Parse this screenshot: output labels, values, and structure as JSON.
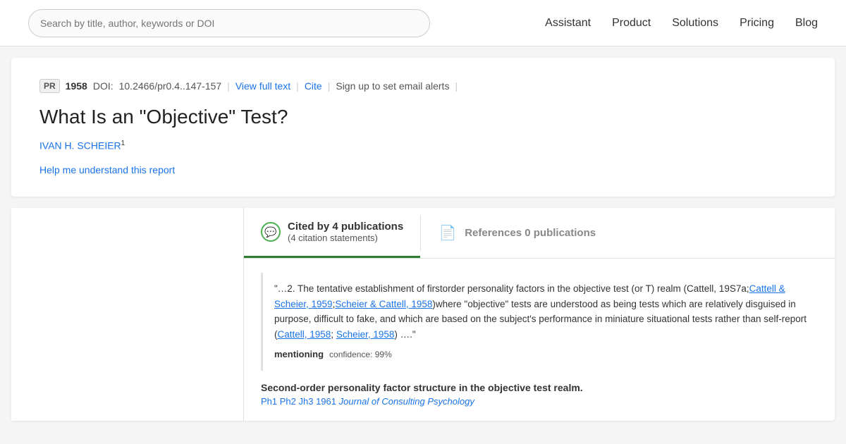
{
  "header": {
    "search_placeholder": "Search by title, author, keywords or DOI",
    "nav_items": [
      "Assistant",
      "Product",
      "Solutions",
      "Pricing",
      "Blog"
    ]
  },
  "article": {
    "badge": "PR",
    "year": "1958",
    "doi_label": "DOI:",
    "doi_value": "10.2466/pr0.4..147-157",
    "view_full_text": "View full text",
    "cite": "Cite",
    "alert": "Sign up to set email alerts",
    "title": "What Is an \"Objective\" Test?",
    "author": "IVAN H. SCHEIER",
    "author_sup": "1",
    "help_link": "Help me understand this report"
  },
  "tabs": {
    "cited_by": {
      "icon": "💬",
      "title": "Cited by 4 publications",
      "subtitle": "(4 citation statements)"
    },
    "references": {
      "icon": "📄",
      "title": "References 0 publications"
    }
  },
  "citation": {
    "text_start": "\"…2. The tentative establishment of firstorder personality factors in the objective test (or T) realm (Cattell, 19S7a;",
    "link1": "Cattell & Scheier, 1959",
    "text2": ";",
    "link2": "Scheier & Cattell, 1958",
    "text3": ")where \"objective\" tests are understood as being tests which are relatively disguised in purpose, difficult to fake, and which are based on the subject's performance in miniature situational tests rather than self-report (",
    "link3": "Cattell, 1958",
    "text4": "; ",
    "link4": "Scheier, 1958",
    "text5": ") ….\"",
    "mentioning_label": "mentioning",
    "confidence_text": "confidence: 99%",
    "second_order_title": "Second-order personality factor structure in the objective test realm.",
    "second_order_refs": "Ph1  Ph2  Jh3",
    "second_order_year": "1961",
    "second_order_journal": "Journal of Consulting Psychology"
  }
}
